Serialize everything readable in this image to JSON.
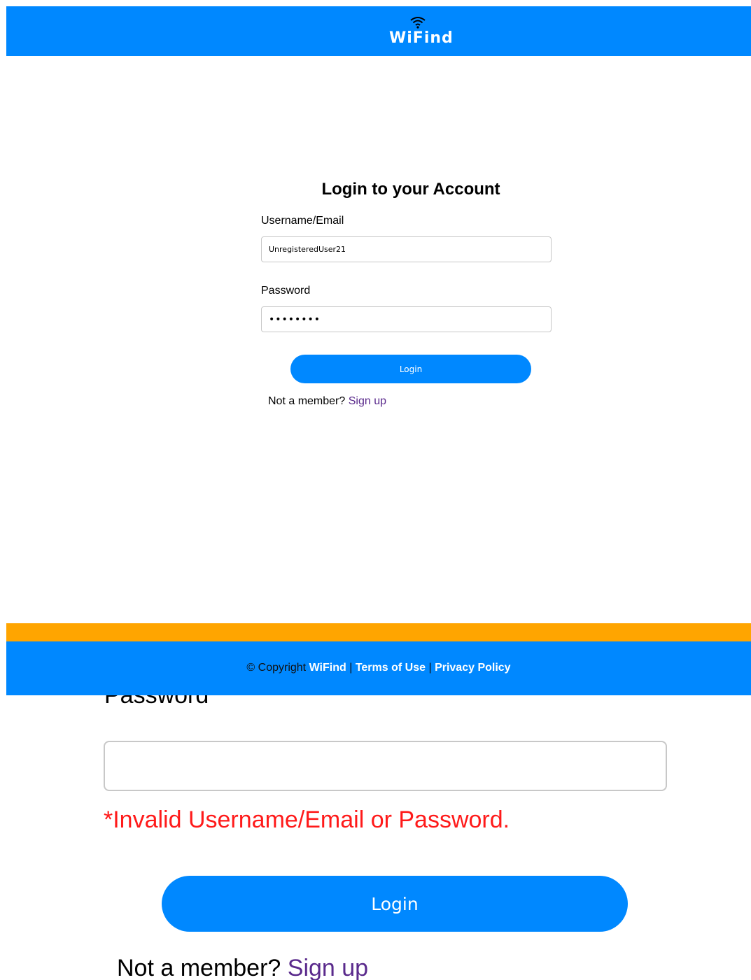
{
  "header": {
    "brand": "WiFind",
    "brand_color": "#0088ff"
  },
  "login_form": {
    "title": "Login to your Account",
    "username_label": "Username/Email",
    "username_value": "UnregisteredUser21",
    "password_label": "Password",
    "password_value": "••••••••",
    "login_button": "Login",
    "signup_prompt": "Not a member?",
    "signup_link": "Sign up"
  },
  "footer": {
    "copyright": "© Copyright",
    "brand": "WiFind",
    "terms": "Terms of Use",
    "privacy": "Privacy Policy",
    "separator": "|",
    "accent_color": "#ffa500"
  },
  "zoomed_view": {
    "password_label": "Password",
    "password_value": "",
    "error_message": "*Invalid Username/Email or Password.",
    "error_color": "#ff1a1a",
    "login_button": "Login",
    "signup_prompt": "Not a member?",
    "signup_link": "Sign up"
  }
}
